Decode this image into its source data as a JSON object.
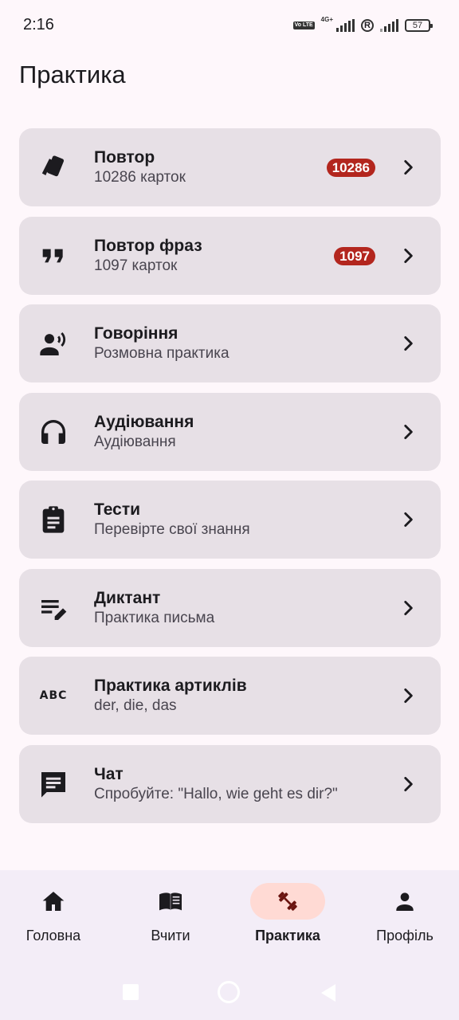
{
  "status_bar": {
    "time": "2:16",
    "volte_label": "Vo LTE",
    "network_label": "4G+",
    "roaming_label": "R",
    "battery_level": "57"
  },
  "page": {
    "title": "Практика"
  },
  "menu": [
    {
      "title": "Повтор",
      "subtitle": "10286 карток",
      "badge": "10286",
      "icon": "cards-icon"
    },
    {
      "title": "Повтор фраз",
      "subtitle": "1097 карток",
      "badge": "1097",
      "icon": "quote-icon"
    },
    {
      "title": "Говоріння",
      "subtitle": "Розмовна практика",
      "icon": "speaking-person-icon"
    },
    {
      "title": "Аудіювання",
      "subtitle": "Аудіювання",
      "icon": "headphones-icon"
    },
    {
      "title": "Тести",
      "subtitle": "Перевірте свої знання",
      "icon": "clipboard-icon"
    },
    {
      "title": "Диктант",
      "subtitle": "Практика письма",
      "icon": "edit-notes-icon"
    },
    {
      "title": "Практика артиклів",
      "subtitle": "der, die, das",
      "icon": "abc-icon"
    },
    {
      "title": "Чат",
      "subtitle": "Спробуйте: \"Hallo, wie geht es dir?\"",
      "icon": "chat-icon"
    }
  ],
  "abc_icon_text": "ABC",
  "bottom_nav": [
    {
      "label": "Головна",
      "icon": "home-icon",
      "active": false
    },
    {
      "label": "Вчити",
      "icon": "book-icon",
      "active": false
    },
    {
      "label": "Практика",
      "icon": "dumbbell-icon",
      "active": true
    },
    {
      "label": "Профіль",
      "icon": "person-icon",
      "active": false
    }
  ],
  "colors": {
    "background": "#fef7fb",
    "card": "#e7e0e6",
    "badge": "#b3261e",
    "active_pill": "#ffdad4",
    "active_icon": "#6a1410"
  }
}
